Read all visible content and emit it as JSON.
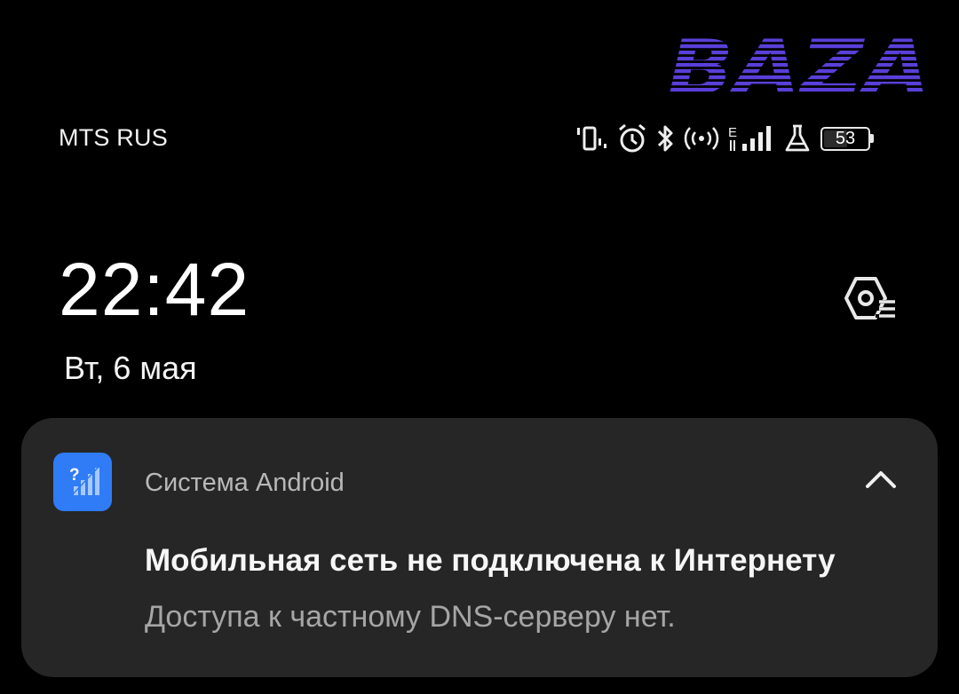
{
  "watermark": {
    "text": "BAZA",
    "color": "#5a3fd8"
  },
  "status_bar": {
    "carrier": "MTS RUS",
    "network_type": "E",
    "battery_level": "53",
    "icons": [
      "vibrate-icon",
      "alarm-icon",
      "bluetooth-icon",
      "hotspot-icon",
      "signal-icon",
      "lab-icon",
      "battery-icon"
    ]
  },
  "lockscreen": {
    "time": "22:42",
    "date": "Вт, 6 мая"
  },
  "notification": {
    "app_name": "Система Android",
    "title": "Мобильная сеть не подключена к Интернету",
    "body": "Доступа к частному DNS-серверу нет.",
    "icon": "no-internet-signal-icon",
    "accent_color": "#2f7cf6"
  }
}
